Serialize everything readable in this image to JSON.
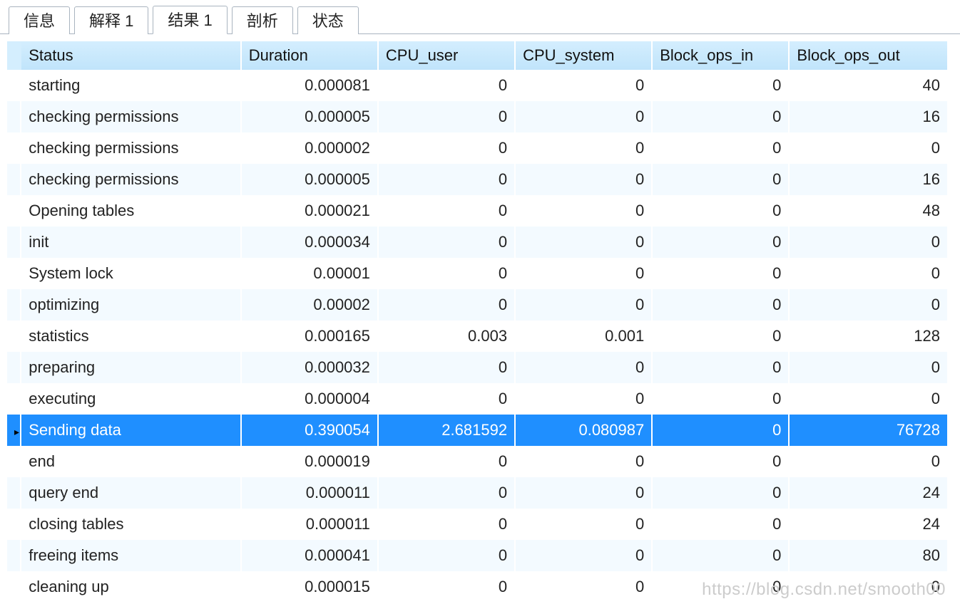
{
  "tabs": [
    {
      "label": "信息",
      "active": false
    },
    {
      "label": "解释 1",
      "active": false
    },
    {
      "label": "结果 1",
      "active": true
    },
    {
      "label": "剖析",
      "active": false
    },
    {
      "label": "状态",
      "active": false
    }
  ],
  "columns": {
    "status": "Status",
    "duration": "Duration",
    "cpu_user": "CPU_user",
    "cpu_system": "CPU_system",
    "block_ops_in": "Block_ops_in",
    "block_ops_out": "Block_ops_out"
  },
  "selected_index": 11,
  "rows": [
    {
      "status": "starting",
      "duration": "0.000081",
      "cpu_user": "0",
      "cpu_system": "0",
      "in": "0",
      "out": "40"
    },
    {
      "status": "checking permissions",
      "duration": "0.000005",
      "cpu_user": "0",
      "cpu_system": "0",
      "in": "0",
      "out": "16"
    },
    {
      "status": "checking permissions",
      "duration": "0.000002",
      "cpu_user": "0",
      "cpu_system": "0",
      "in": "0",
      "out": "0"
    },
    {
      "status": "checking permissions",
      "duration": "0.000005",
      "cpu_user": "0",
      "cpu_system": "0",
      "in": "0",
      "out": "16"
    },
    {
      "status": "Opening tables",
      "duration": "0.000021",
      "cpu_user": "0",
      "cpu_system": "0",
      "in": "0",
      "out": "48"
    },
    {
      "status": "init",
      "duration": "0.000034",
      "cpu_user": "0",
      "cpu_system": "0",
      "in": "0",
      "out": "0"
    },
    {
      "status": "System lock",
      "duration": "0.00001",
      "cpu_user": "0",
      "cpu_system": "0",
      "in": "0",
      "out": "0"
    },
    {
      "status": "optimizing",
      "duration": "0.00002",
      "cpu_user": "0",
      "cpu_system": "0",
      "in": "0",
      "out": "0"
    },
    {
      "status": "statistics",
      "duration": "0.000165",
      "cpu_user": "0.003",
      "cpu_system": "0.001",
      "in": "0",
      "out": "128"
    },
    {
      "status": "preparing",
      "duration": "0.000032",
      "cpu_user": "0",
      "cpu_system": "0",
      "in": "0",
      "out": "0"
    },
    {
      "status": "executing",
      "duration": "0.000004",
      "cpu_user": "0",
      "cpu_system": "0",
      "in": "0",
      "out": "0"
    },
    {
      "status": "Sending data",
      "duration": "0.390054",
      "cpu_user": "2.681592",
      "cpu_system": "0.080987",
      "in": "0",
      "out": "76728"
    },
    {
      "status": "end",
      "duration": "0.000019",
      "cpu_user": "0",
      "cpu_system": "0",
      "in": "0",
      "out": "0"
    },
    {
      "status": "query end",
      "duration": "0.000011",
      "cpu_user": "0",
      "cpu_system": "0",
      "in": "0",
      "out": "24"
    },
    {
      "status": "closing tables",
      "duration": "0.000011",
      "cpu_user": "0",
      "cpu_system": "0",
      "in": "0",
      "out": "24"
    },
    {
      "status": "freeing items",
      "duration": "0.000041",
      "cpu_user": "0",
      "cpu_system": "0",
      "in": "0",
      "out": "80"
    },
    {
      "status": "cleaning up",
      "duration": "0.000015",
      "cpu_user": "0",
      "cpu_system": "0",
      "in": "0",
      "out": "0"
    }
  ],
  "watermark": "https://blog.csdn.net/smooth00"
}
